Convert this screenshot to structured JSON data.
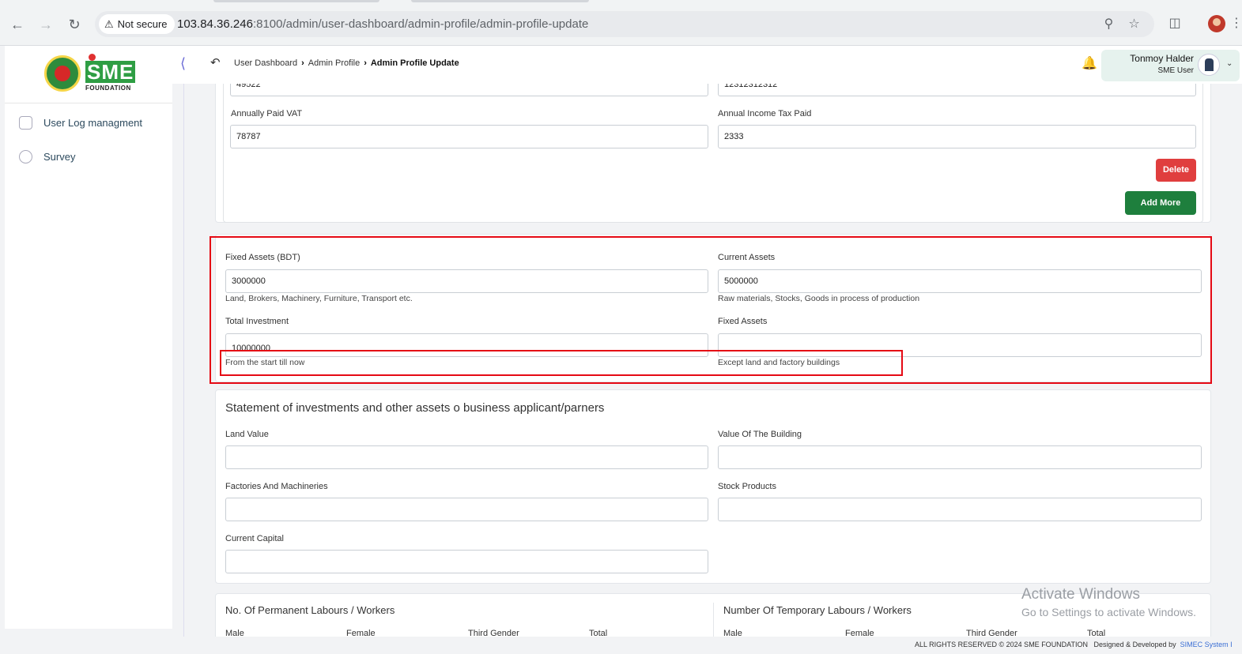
{
  "browser": {
    "security_label": "Not secure",
    "url_host": "103.84.36.246",
    "url_rest": ":8100/admin/user-dashboard/admin-profile/admin-profile-update"
  },
  "sidebar": {
    "logo_text": "SME",
    "logo_sub": "FOUNDATION",
    "items": [
      {
        "label": "User Log managment",
        "icon": "log-icon"
      },
      {
        "label": "Survey",
        "icon": "pie-chart-icon"
      }
    ]
  },
  "header": {
    "breadcrumb": [
      "User Dashboard",
      "Admin Profile",
      "Admin Profile Update"
    ],
    "user_name": "Tonmoy Halder",
    "user_role": "SME User"
  },
  "tax_panel": {
    "row0_left_value": "49522",
    "row0_right_value": "12312312312",
    "vat_label": "Annually Paid VAT",
    "vat_value": "78787",
    "income_tax_label": "Annual Income Tax Paid",
    "income_tax_value": "2333",
    "delete_label": "Delete",
    "add_more_label": "Add More"
  },
  "assets_panel": {
    "fixed_assets_bdt_label": "Fixed Assets (BDT)",
    "fixed_assets_bdt_value": "3000000",
    "fixed_assets_bdt_help": "Land, Brokers, Machinery, Furniture, Transport etc.",
    "current_assets_label": "Current Assets",
    "current_assets_value": "5000000",
    "current_assets_help": "Raw materials, Stocks, Goods in process of production",
    "total_investment_label": "Total Investment",
    "total_investment_value": "10000000",
    "total_investment_help": "From the start till now",
    "fixed_assets_label": "Fixed Assets",
    "fixed_assets_value": "",
    "fixed_assets_help": "Except land and factory buildings"
  },
  "statement_panel": {
    "title": "Statement of investments and other assets o business applicant/parners",
    "land_value_label": "Land Value",
    "building_value_label": "Value Of The Building",
    "factories_label": "Factories And Machineries",
    "stock_label": "Stock Products",
    "current_capital_label": "Current Capital"
  },
  "labour_panel": {
    "permanent_title": "No. Of Permanent Labours / Workers",
    "temporary_title": "Number Of Temporary Labours / Workers",
    "columns": [
      "Male",
      "Female",
      "Third Gender",
      "Total"
    ]
  },
  "watermark": {
    "line1": "Activate Windows",
    "line2": "Go to Settings to activate Windows."
  },
  "footer": {
    "rights": "ALL RIGHTS RESERVED © 2024 SME FOUNDATION",
    "designed": "Designed & Developed by",
    "developer": "SIMEC System I"
  },
  "colors": {
    "highlight": "#e50914",
    "brand_green": "#1e7f3d",
    "delete_red": "#e03e3e"
  }
}
